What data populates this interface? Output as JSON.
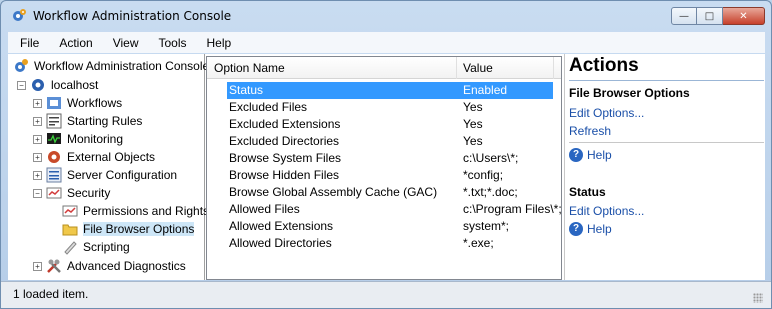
{
  "window": {
    "title": "Workflow Administration Console"
  },
  "menu": [
    "File",
    "Action",
    "View",
    "Tools",
    "Help"
  ],
  "tree": {
    "root": "Workflow Administration Console",
    "host": "localhost",
    "items": [
      {
        "label": "Workflows",
        "expander": "+"
      },
      {
        "label": "Starting Rules",
        "expander": "+"
      },
      {
        "label": "Monitoring",
        "expander": "+"
      },
      {
        "label": "External Objects",
        "expander": "+"
      },
      {
        "label": "Server Configuration",
        "expander": "+"
      },
      {
        "label": "Security",
        "expander": "-"
      },
      {
        "label": "Permissions and Rights"
      },
      {
        "label": "File Browser Options"
      },
      {
        "label": "Scripting"
      },
      {
        "label": "Advanced Diagnostics",
        "expander": "+"
      }
    ]
  },
  "list": {
    "headers": [
      "Option Name",
      "Value"
    ],
    "rows": [
      {
        "name": "Status",
        "value": "Enabled"
      },
      {
        "name": "Excluded Files",
        "value": "Yes"
      },
      {
        "name": "Excluded Extensions",
        "value": "Yes"
      },
      {
        "name": "Excluded Directories",
        "value": "Yes"
      },
      {
        "name": "Browse System Files",
        "value": "c:\\Users\\*;"
      },
      {
        "name": "Browse Hidden Files",
        "value": "*config;"
      },
      {
        "name": "Browse Global Assembly Cache (GAC)",
        "value": "*.txt;*.doc;"
      },
      {
        "name": "Allowed Files",
        "value": "c:\\Program Files\\*;"
      },
      {
        "name": "Allowed Extensions",
        "value": "system*;"
      },
      {
        "name": "Allowed Directories",
        "value": "*.exe;"
      }
    ]
  },
  "actions": {
    "title": "Actions",
    "section1": {
      "title": "File Browser Options",
      "edit": "Edit Options...",
      "refresh": "Refresh",
      "help": "Help"
    },
    "section2": {
      "title": "Status",
      "edit": "Edit Options...",
      "help": "Help"
    }
  },
  "status": {
    "text": "1 loaded item."
  },
  "colors": {
    "selection": "#3399ff",
    "link": "#1a4fa8",
    "tree_selected": "#cde6f7"
  }
}
